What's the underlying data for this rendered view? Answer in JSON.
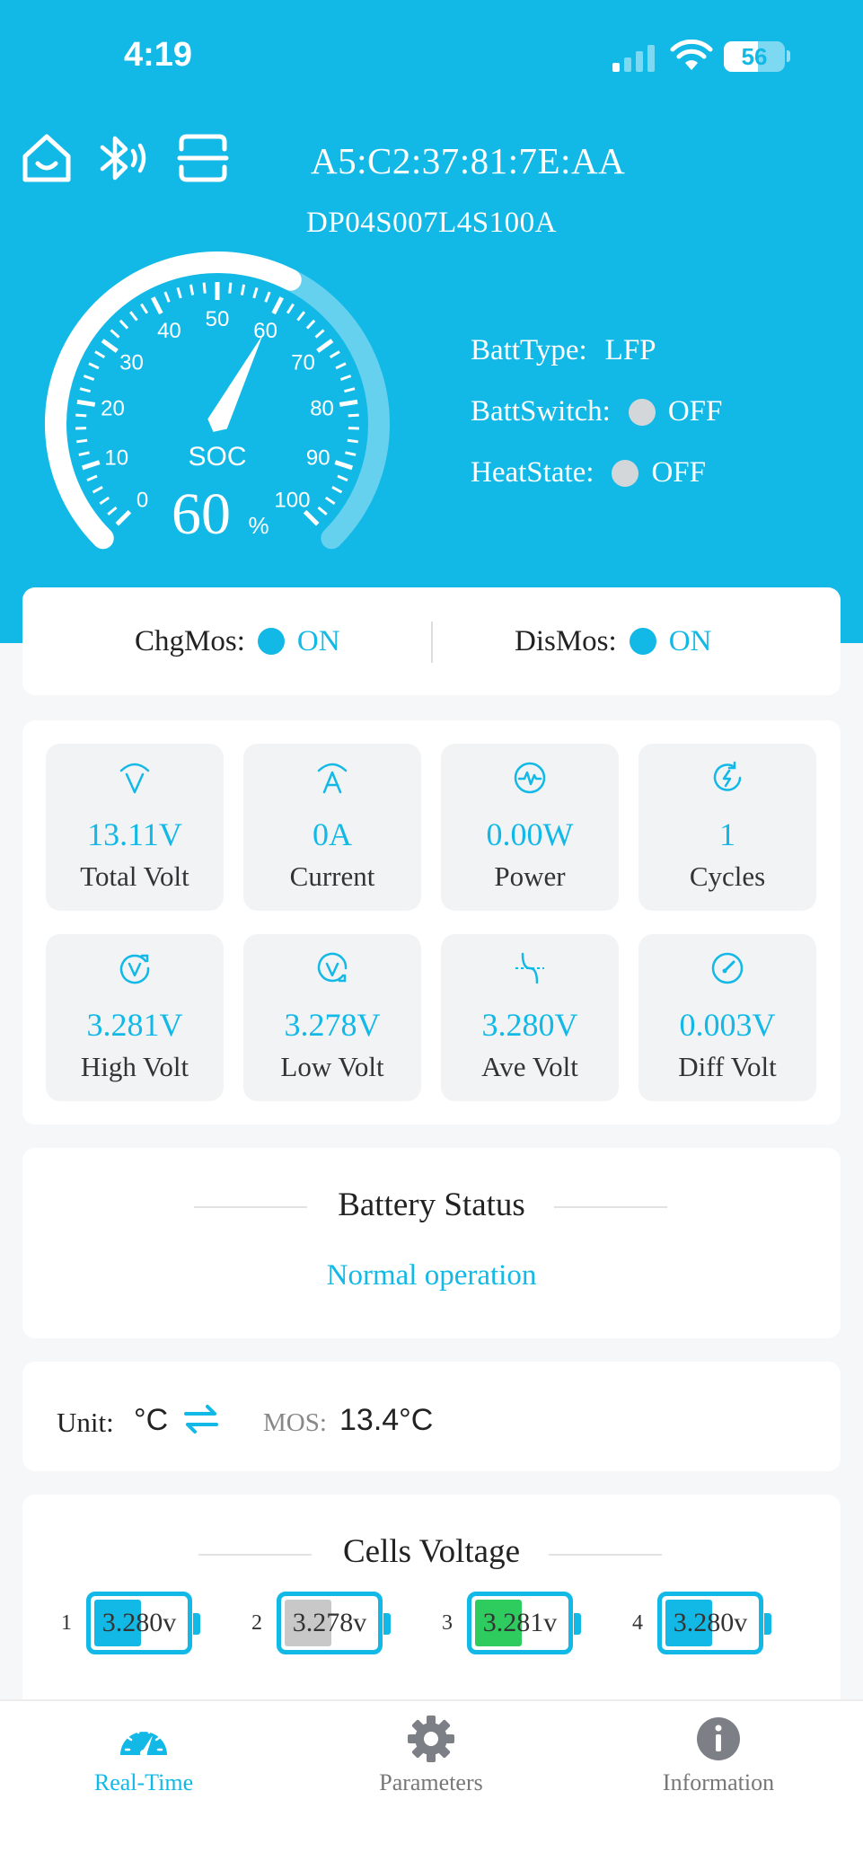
{
  "status_bar": {
    "time": "4:19",
    "battery_level": "56"
  },
  "header": {
    "mac_address": "A5:C2:37:81:7E:AA",
    "model": "DP04S007L4S100A",
    "icons": [
      "home-icon",
      "bluetooth-icon",
      "scan-icon"
    ]
  },
  "gauge": {
    "label": "SOC",
    "value": 60,
    "value_text": "60",
    "unit": "%",
    "ticks": [
      "0",
      "10",
      "20",
      "30",
      "40",
      "50",
      "60",
      "70",
      "80",
      "90",
      "100"
    ]
  },
  "info": {
    "batt_type_label": "BattType:",
    "batt_type_value": "LFP",
    "batt_switch_label": "BattSwitch:",
    "batt_switch_value": "OFF",
    "heat_state_label": "HeatState:",
    "heat_state_value": "OFF"
  },
  "mos": {
    "chg_label": "ChgMos:",
    "chg_value": "ON",
    "dis_label": "DisMos:",
    "dis_value": "ON"
  },
  "metrics": [
    {
      "icon": "voltage-icon",
      "value": "13.11V",
      "label": "Total Volt"
    },
    {
      "icon": "current-icon",
      "value": "0A",
      "label": "Current"
    },
    {
      "icon": "power-icon",
      "value": "0.00W",
      "label": "Power"
    },
    {
      "icon": "cycles-icon",
      "value": "1",
      "label": "Cycles"
    },
    {
      "icon": "high-volt-icon",
      "value": "3.281V",
      "label": "High Volt"
    },
    {
      "icon": "low-volt-icon",
      "value": "3.278V",
      "label": "Low Volt"
    },
    {
      "icon": "ave-volt-icon",
      "value": "3.280V",
      "label": "Ave Volt"
    },
    {
      "icon": "diff-volt-icon",
      "value": "0.003V",
      "label": "Diff Volt"
    }
  ],
  "battery_status": {
    "title": "Battery Status",
    "text": "Normal operation"
  },
  "temperature": {
    "unit_label": "Unit:",
    "unit_value": "°C",
    "mos_label": "MOS:",
    "mos_value": "13.4°C"
  },
  "cells": {
    "title": "Cells Voltage",
    "items": [
      {
        "index": "1",
        "value": "3.280v",
        "color": "#13b9e6"
      },
      {
        "index": "2",
        "value": "3.278v",
        "color": "#c8c8c8"
      },
      {
        "index": "3",
        "value": "3.281v",
        "color": "#2ecc5f"
      },
      {
        "index": "4",
        "value": "3.280v",
        "color": "#13b9e6"
      }
    ]
  },
  "tabs": [
    {
      "label": "Real-Time",
      "active": true
    },
    {
      "label": "Parameters",
      "active": false
    },
    {
      "label": "Information",
      "active": false
    }
  ],
  "colors": {
    "accent": "#13b9e6",
    "background": "#f6f7f8",
    "off_dot": "#d4d7da"
  }
}
